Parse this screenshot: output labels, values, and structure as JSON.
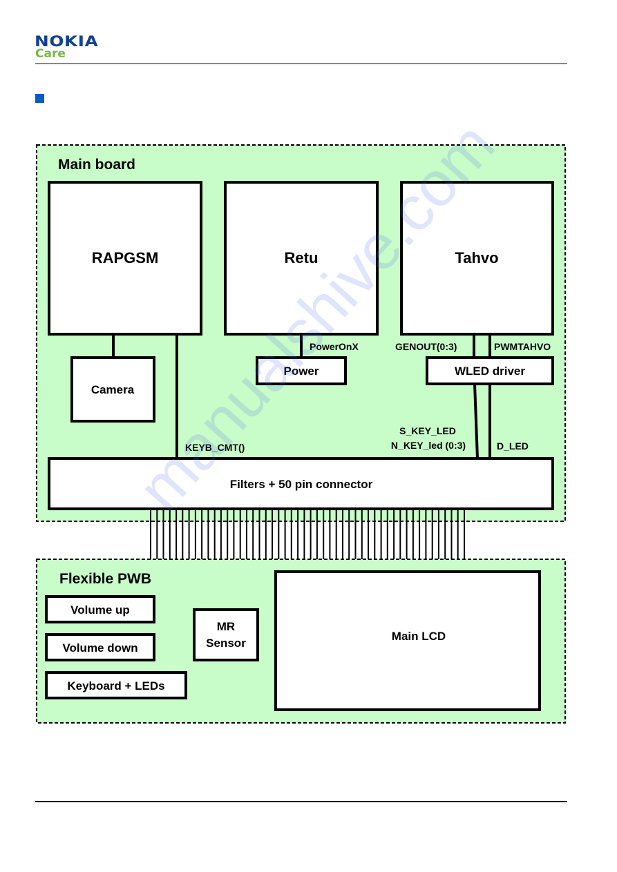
{
  "header": {
    "brand": "NOKIA",
    "sub_brand": "Care",
    "brand_color": "#124191",
    "sub_brand_color": "#7ab648",
    "bullet_color": "#0b5bc4"
  },
  "diagram": {
    "board_fill": "#c8fcc8",
    "main_board": {
      "title": "Main board",
      "blocks": {
        "rapgsm": "RAPGSM",
        "retu": "Retu",
        "tahvo": "Tahvo",
        "camera": "Camera",
        "power": "Power",
        "wled_driver": "WLED driver",
        "filters_connector": "Filters + 50 pin connector"
      },
      "signals": {
        "power_on_x": "PowerOnX",
        "genout": "GENOUT(0:3)",
        "pwmtahvo": "PWMTAHVO",
        "s_key_led": "S_KEY_LED",
        "n_key_led": "N_KEY_led (0:3)",
        "d_led": "D_LED",
        "keyb_cmt": "KEYB_CMT()"
      }
    },
    "connector_pin_count": 50,
    "flexible_pwb": {
      "title": "Flexible PWB",
      "blocks": {
        "volume_up": "Volume up",
        "volume_down": "Volume down",
        "keyboard_leds": "Keyboard + LEDs",
        "mr_sensor_line1": "MR",
        "mr_sensor_line2": "Sensor",
        "main_lcd": "Main LCD"
      }
    }
  },
  "watermark": "manualshive.com"
}
